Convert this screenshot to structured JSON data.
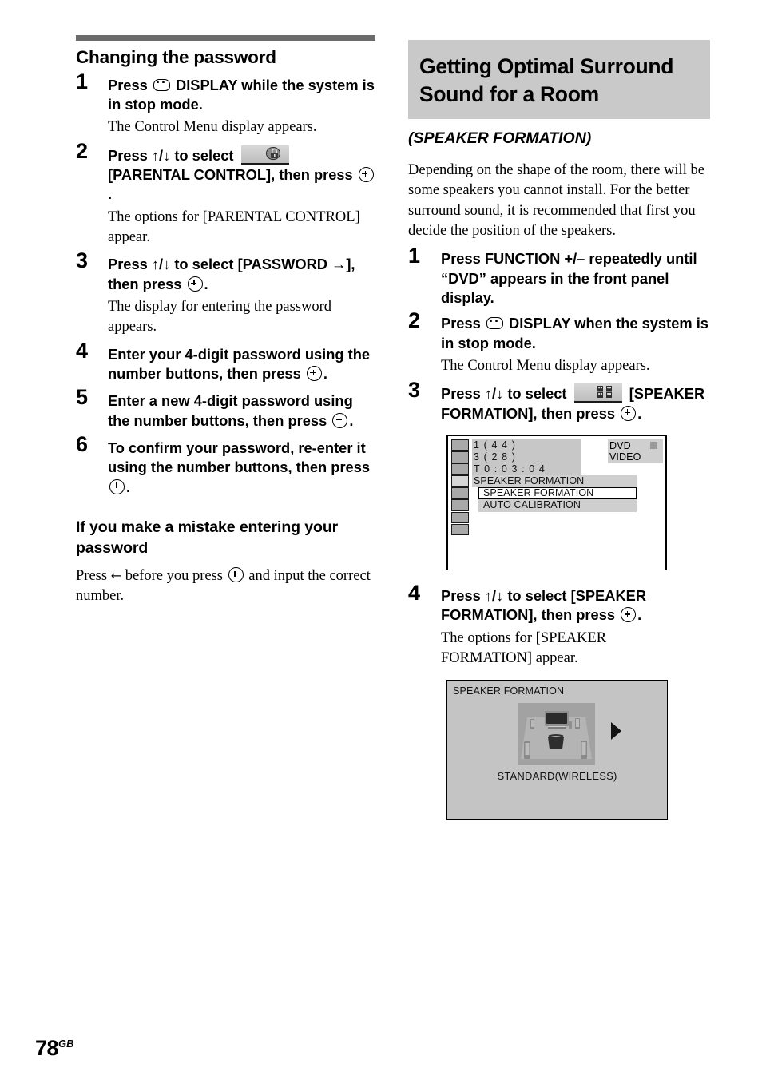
{
  "page": {
    "number": "78",
    "region_suffix": "GB"
  },
  "left_column": {
    "section_heading": "Changing the password",
    "steps": [
      {
        "num": "1",
        "text_before_icon": "Press",
        "icon": "display-button-icon",
        "text_after_icon": "DISPLAY while the system is in stop mode.",
        "result": "The Control Menu display appears."
      },
      {
        "num": "2",
        "text_before_icon": "Press ↑/↓ to select",
        "icon": "parental-control-icon",
        "text_after_icon": "[PARENTAL CONTROL], then press",
        "end_icon": "enter-button-icon",
        "end_text": ".",
        "result": "The options for [PARENTAL CONTROL] appear."
      },
      {
        "num": "3",
        "text": "Press ↑/↓ to select [PASSWORD →], then press",
        "end_icon": "enter-button-icon",
        "end_text": ".",
        "result": "The display for entering the password appears."
      },
      {
        "num": "4",
        "text": "Enter your 4-digit password using the number buttons, then press",
        "end_icon": "enter-button-icon",
        "end_text": "."
      },
      {
        "num": "5",
        "text": "Enter a new 4-digit password using the number buttons, then press",
        "end_icon": "enter-button-icon",
        "end_text": "."
      },
      {
        "num": "6",
        "text": "To confirm your password, re-enter it using the number buttons, then press",
        "end_icon": "enter-button-icon",
        "end_text": "."
      }
    ],
    "subsection_heading": "If you make a mistake entering your password",
    "subsection_body_1": "Press",
    "subsection_arrow_icon": "←",
    "subsection_body_2": "before you press",
    "subsection_body_3": "and input the correct number."
  },
  "right_column": {
    "main_heading_line1": "Getting Optimal Surround",
    "main_heading_line2": "Sound for a Room",
    "subtitle": "(SPEAKER FORMATION)",
    "intro": "Depending on the shape of the room, there will be some speakers you cannot install. For the better surround sound, it is recommended that first you decide the position of the speakers.",
    "steps": [
      {
        "num": "1",
        "text": "Press FUNCTION +/– repeatedly until “DVD” appears in the front panel display."
      },
      {
        "num": "2",
        "text_before_icon": "Press",
        "icon": "display-button-icon",
        "text_after_icon": "DISPLAY when the system is in stop mode.",
        "result": "The Control Menu display appears."
      },
      {
        "num": "3",
        "text_before_icon": "Press ↑/↓ to select",
        "icon": "speaker-formation-icon",
        "text_after_icon": "[SPEAKER FORMATION], then press",
        "end_icon": "enter-button-icon",
        "end_text": "."
      },
      {
        "num": "4",
        "text": "Press ↑/↓ to select [SPEAKER FORMATION], then press",
        "end_icon": "enter-button-icon",
        "end_text": ".",
        "result": "The options for [SPEAKER FORMATION] appear."
      }
    ],
    "control_menu": {
      "line_chapter": "1 ( 4 4 )",
      "line_track": "3 ( 2 8 )",
      "line_time": "T    0 : 0 3 : 0 4",
      "line_current": "SPEAKER FORMATION",
      "option_selected": "SPEAKER FORMATION",
      "option_other": "AUTO CALIBRATION",
      "disc_type": "DVD VIDEO",
      "icon_cells": 8,
      "selected_cell_index": 4
    },
    "speaker_formation_panel": {
      "title": "SPEAKER FORMATION",
      "caption": "STANDARD(WIRELESS)",
      "next_arrow_icon": "right-triangle-icon"
    }
  },
  "colors": {
    "heading_bar": "#6b6b6b",
    "heading_box_bg": "#c9c9c9",
    "osd_shade": "#c7c7c7",
    "osd_panel_bg": "#c4c4c4"
  }
}
